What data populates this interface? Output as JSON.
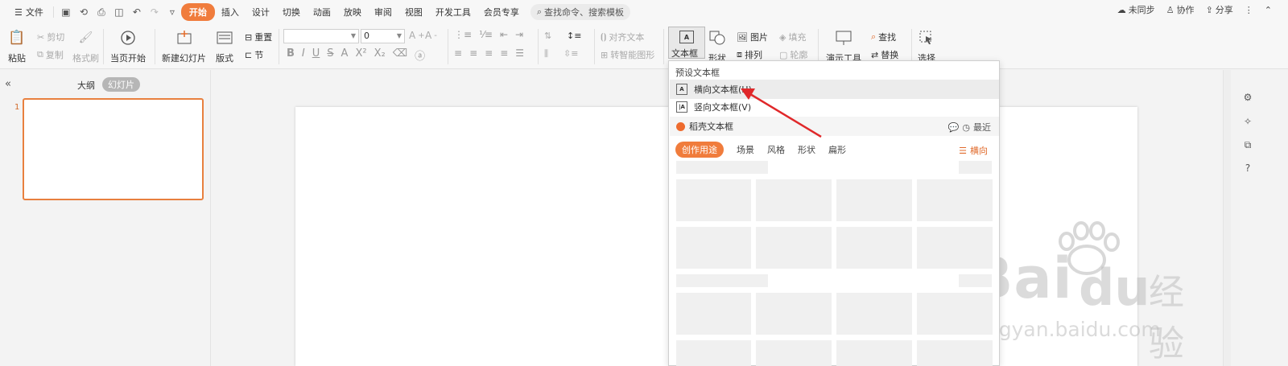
{
  "menubar": {
    "file": "文件",
    "tabs": [
      "开始",
      "插入",
      "设计",
      "切换",
      "动画",
      "放映",
      "审阅",
      "视图",
      "开发工具",
      "会员专享"
    ],
    "active_tab": "开始",
    "search_placeholder": "查找命令、搜索模板",
    "sync": "未同步",
    "collab": "协作",
    "share": "分享"
  },
  "ribbon": {
    "paste": "粘贴",
    "cut": "剪切",
    "copy": "复制",
    "format_painter": "格式刷",
    "from_current": "当页开始",
    "new_slide": "新建幻灯片",
    "layout": "版式",
    "reset": "重置",
    "section": "节",
    "font_size": "0",
    "align_text": "对齐文本",
    "smart_graphic": "转智能图形",
    "textbox": "文本框",
    "shape": "形状",
    "picture": "图片",
    "fill": "填充",
    "arrange": "排列",
    "outline": "轮廓",
    "presenter_tools": "演示工具",
    "find": "查找",
    "replace": "替换",
    "select": "选择"
  },
  "left_panel": {
    "outline_tab": "大纲",
    "slides_tab": "幻灯片",
    "slide_number": "1"
  },
  "dropdown": {
    "header": "预设文本框",
    "items": [
      "横向文本框(H)",
      "竖向文本框(V)"
    ],
    "brand": "稻壳文本框",
    "recent": "最近",
    "tabs": [
      "创作用途",
      "场景",
      "风格",
      "形状",
      "扁形"
    ],
    "orientation": "横向"
  },
  "watermark": {
    "brand": "Bai",
    "suffix": "经验",
    "url": "jingyan.baidu.com"
  },
  "colors": {
    "accent": "#f07c3c",
    "arrow": "#e0282a"
  }
}
